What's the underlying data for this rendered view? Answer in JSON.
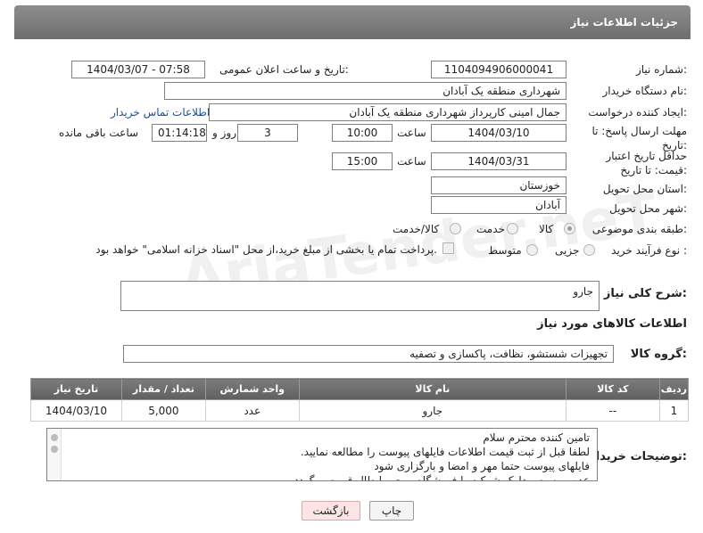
{
  "header": {
    "title": "جزئیات اطلاعات نیاز"
  },
  "fields": {
    "need_number_label": "شماره نیاز:",
    "need_number": "1104094906000041",
    "announce_label": "تاریخ و ساعت اعلان عمومی:",
    "announce_value": "1404/03/07 - 07:58",
    "buyer_label": "نام دستگاه خریدار:",
    "buyer_value": "شهرداری منطقه یک آبادان",
    "creator_label": "ایجاد کننده درخواست:",
    "creator_value": "جمال امینی کارپرداز شهرداری منطقه یک آبادان",
    "contact_link": "اطلاعات تماس خریدار",
    "reply_label": "مهلت ارسال پاسخ: تا تاریخ:",
    "reply_date": "1404/03/10",
    "reply_time_label": "ساعت",
    "reply_time": "10:00",
    "days_value": "3",
    "days_label": "روز و",
    "remaining_value": "01:14:18",
    "remaining_label": "ساعت باقی مانده",
    "price_label": "حداقل تاریخ اعتبار قیمت: تا تاریخ:",
    "price_date": "1404/03/31",
    "price_time_label": "ساعت",
    "price_time": "15:00",
    "province_label": "استان محل تحویل:",
    "province_value": "خوزستان",
    "city_label": "شهر محل تحویل:",
    "city_value": "آبادان",
    "category_label": "طبقه بندی موضوعی:",
    "category_options": [
      "کالا",
      "خدمت",
      "کالا/خدمت"
    ],
    "process_label": "نوع فرآیند خرید :",
    "process_options": [
      "جزیی",
      "متوسط"
    ],
    "payment_note": "پرداخت تمام یا بخشی از مبلغ خرید،از محل \"اسناد خزانه اسلامی\" خواهد بود."
  },
  "summary": {
    "label": "شرح کلی نیاز:",
    "value": "جارو"
  },
  "goods_section_title": "اطلاعات کالاهای مورد نیاز",
  "group": {
    "label": "گروه کالا:",
    "value": "تجهیزات شستشو، نظافت، پاکسازی و تصفیه"
  },
  "table": {
    "headers": [
      "ردیف",
      "کد کالا",
      "نام کالا",
      "واحد شمارش",
      "تعداد / مقدار",
      "تاریخ نیاز"
    ],
    "rows": [
      [
        "1",
        "--",
        "جارو",
        "عدد",
        "5,000",
        "1404/03/10"
      ]
    ]
  },
  "notes": {
    "label": "توضیحات خریدار:",
    "lines": [
      "تامین کننده محترم سلام",
      "لطفا قبل از ثبت قیمت اطلاعات فایلهای پیوست را مطالعه نمایید.",
      "فایلهای پیوست حتما مهر و امضا و بارگزاری شود",
      "عدم پیوست مدارک شرکت یا فروشگاه موجب ابطال قیمت میگردد."
    ]
  },
  "buttons": {
    "print": "چاپ",
    "back": "بازگشت"
  },
  "watermark": "AriaTender.neT"
}
